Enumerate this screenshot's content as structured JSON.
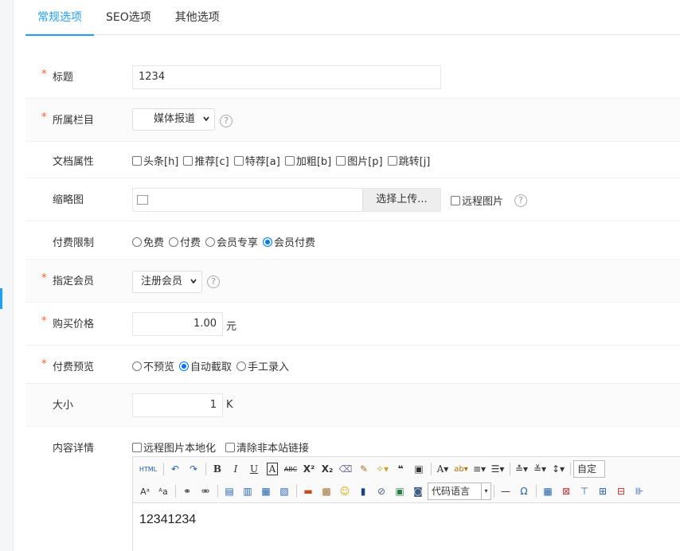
{
  "tabs": [
    {
      "label": "常规选项",
      "active": true
    },
    {
      "label": "SEO选项",
      "active": false
    },
    {
      "label": "其他选项",
      "active": false
    }
  ],
  "required_mark": "*",
  "title_field": {
    "label": "标题",
    "value": "1234"
  },
  "category_field": {
    "label": "所属栏目",
    "value": "媒体报道"
  },
  "doc_attrs": {
    "label": "文档属性",
    "options": [
      "头条[h]",
      "推荐[c]",
      "特荐[a]",
      "加粗[b]",
      "图片[p]",
      "跳转[j]"
    ]
  },
  "thumbnail": {
    "label": "缩略图",
    "button": "选择上传...",
    "remote_label": "远程图片"
  },
  "paid_limit": {
    "label": "付费限制",
    "options": [
      "免费",
      "付费",
      "会员专享",
      "会员付费"
    ],
    "selected": "会员付费"
  },
  "member_field": {
    "label": "指定会员",
    "value": "注册会员"
  },
  "price_field": {
    "label": "购买价格",
    "value": "1.00",
    "unit": "元"
  },
  "preview_field": {
    "label": "付费预览",
    "options": [
      "不预览",
      "自动截取",
      "手工录入"
    ],
    "selected": "自动截取"
  },
  "size_field": {
    "label": "大小",
    "value": "1",
    "unit": "K"
  },
  "content_field": {
    "label": "内容详情",
    "options": [
      "远程图片本地化",
      "清除非本站链接"
    ]
  },
  "help_symbol": "?",
  "editor": {
    "html_label": "HTML",
    "custom_label": "自定",
    "code_lang_label": "代码语言",
    "content": "12341234"
  },
  "colors": {
    "accent": "#1e9fff",
    "required": "#ff5722",
    "radio": "#0075ff"
  }
}
